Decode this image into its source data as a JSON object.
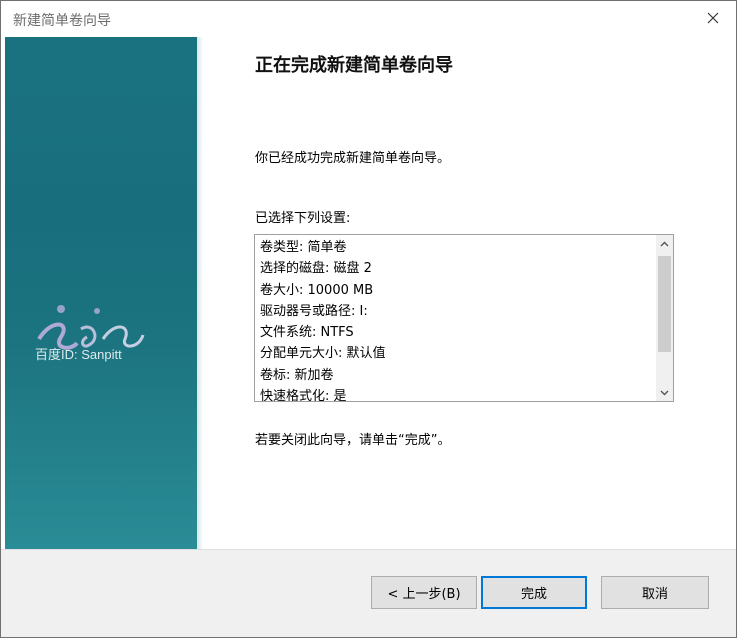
{
  "window": {
    "title": "新建简单卷向导"
  },
  "page": {
    "heading": "正在完成新建简单卷向导",
    "done_text": "你已经成功完成新建简单卷向导。",
    "settings_label": "已选择下列设置:",
    "settings": [
      "卷类型: 简单卷",
      "选择的磁盘: 磁盘 2",
      "卷大小: 10000 MB",
      "驱动器号或路径: I:",
      "文件系统: NTFS",
      "分配单元大小: 默认值",
      "卷标: 新加卷",
      "快速格式化: 是"
    ],
    "close_hint": "若要关闭此向导，请单击“完成”。"
  },
  "banner": {
    "watermark_text": "百度ID: Sanpitt"
  },
  "buttons": {
    "back": "< 上一步(B)",
    "finish": "完成",
    "cancel": "取消"
  },
  "colors": {
    "banner": "#1a7280",
    "focus": "#0078d7"
  },
  "icons": {
    "close": "close-icon",
    "scroll_up": "chevron-up-icon",
    "scroll_down": "chevron-down-icon"
  }
}
